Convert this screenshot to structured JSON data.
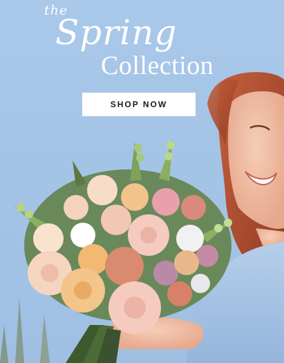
{
  "hero": {
    "title_prefix": "the",
    "title_script": "Spring",
    "title_main": "Collection",
    "cta_label": "SHOP NOW"
  },
  "colors": {
    "sky": "#a6c5e8",
    "title_text": "#ffffff",
    "button_bg": "#ffffff",
    "button_text": "#1a1a1a"
  }
}
